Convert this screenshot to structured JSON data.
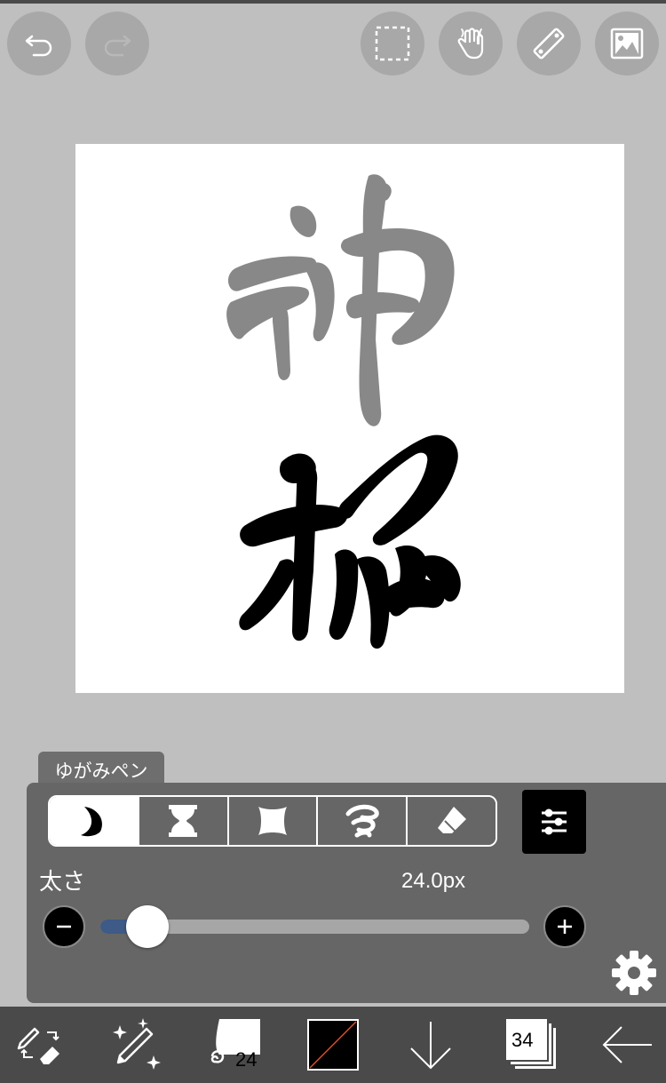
{
  "toolbar": {
    "undo_icon": "undo-icon",
    "redo_icon": "redo-icon",
    "select_icon": "selection-icon",
    "hand_icon": "hand-icon",
    "ruler_icon": "ruler-icon",
    "image_icon": "image-icon"
  },
  "canvas": {
    "background": "#ffffff",
    "stroke_colors": [
      "#888888",
      "#000000"
    ]
  },
  "brush_panel": {
    "brush_name": "ゆがみペン",
    "modes": [
      "crescent-icon",
      "hourglass-icon",
      "diamond-icon",
      "swirl-icon",
      "eraser-icon"
    ],
    "active_mode_index": 0,
    "size_label": "太さ",
    "size_value": "24.0px",
    "size_slider_fraction": 0.11,
    "accent_color": "#3e5a86"
  },
  "bottom_bar": {
    "brush_size": "24",
    "layer_count": "34",
    "color_icon": "color-swatch-icon"
  }
}
